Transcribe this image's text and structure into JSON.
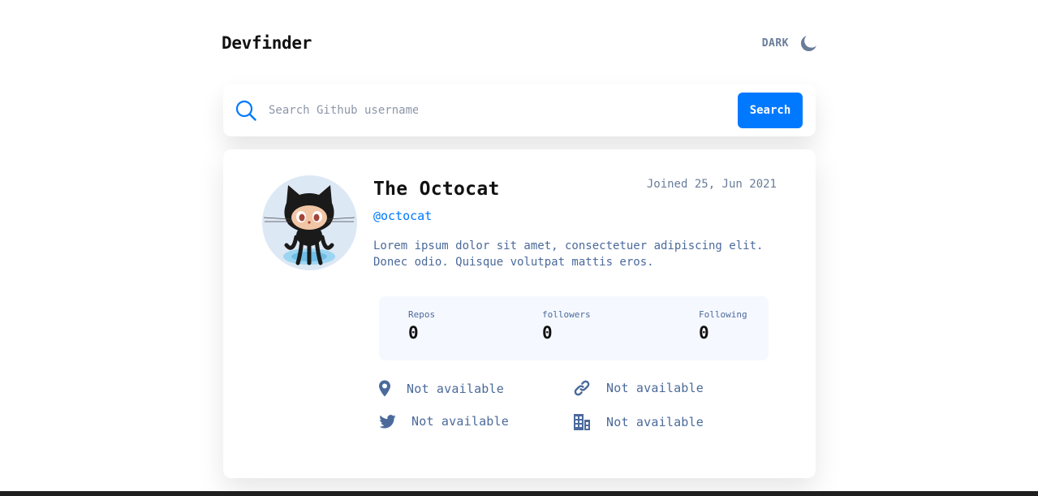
{
  "app": {
    "logo": "Devfinder",
    "theme_toggle": {
      "label": "DARK",
      "icon": "moon-icon"
    }
  },
  "search": {
    "placeholder": "Search Github username",
    "value": "",
    "button_label": "Search",
    "icon": "search-icon"
  },
  "profile": {
    "name": "The Octocat",
    "login": "@octocat",
    "joined": "Joined 25, Jun 2021",
    "bio": "Lorem ipsum dolor sit amet, consectetuer adipiscing elit. Donec odio. Quisque volutpat mattis eros.",
    "avatar": "octocat-avatar",
    "stats": [
      {
        "label": "Repos",
        "value": "0"
      },
      {
        "label": "followers",
        "value": "0"
      },
      {
        "label": "Following",
        "value": "0"
      }
    ],
    "links": {
      "location": {
        "icon": "location-pin-icon",
        "text": "Not available"
      },
      "blog": {
        "icon": "link-icon",
        "text": "Not available"
      },
      "twitter": {
        "icon": "twitter-icon",
        "text": "Not available"
      },
      "company": {
        "icon": "building-icon",
        "text": "Not available"
      }
    }
  },
  "colors": {
    "accent": "#0079ff",
    "text_muted": "#4b6a9b",
    "text_dark": "#111111",
    "stats_bg": "#f6f8ff",
    "icon": "#4b6a9b"
  }
}
